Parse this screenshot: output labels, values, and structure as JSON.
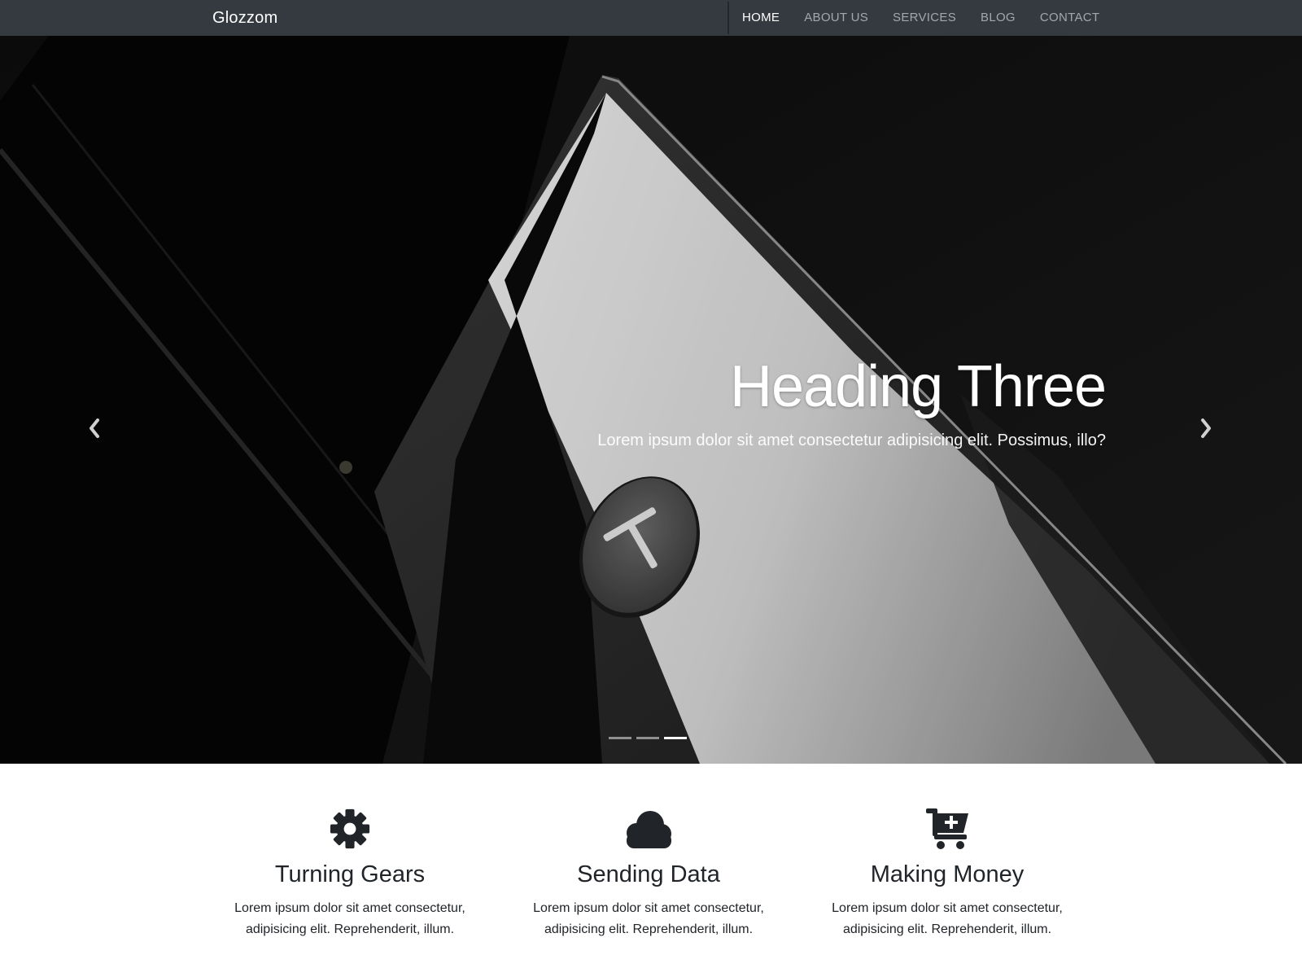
{
  "navbar": {
    "brand": "Glozzom",
    "links": [
      {
        "label": "HOME",
        "active": true
      },
      {
        "label": "ABOUT US",
        "active": false
      },
      {
        "label": "SERVICES",
        "active": false
      },
      {
        "label": "BLOG",
        "active": false
      },
      {
        "label": "CONTACT",
        "active": false
      }
    ]
  },
  "hero": {
    "title": "Heading Three",
    "text": "Lorem ipsum dolor sit amet consectetur adipisicing elit. Possimus, illo?",
    "prev_icon": "chevron-left-icon",
    "next_icon": "chevron-right-icon",
    "slide_count": 3,
    "active_slide": 3
  },
  "features": [
    {
      "icon": "gear-icon",
      "title": "Turning Gears",
      "line1": "Lorem ipsum dolor sit amet consectetur,",
      "line2": "adipisicing elit. Reprehenderit, illum."
    },
    {
      "icon": "cloud-icon",
      "title": "Sending Data",
      "line1": "Lorem ipsum dolor sit amet consectetur,",
      "line2": "adipisicing elit. Reprehenderit, illum."
    },
    {
      "icon": "cart-plus-icon",
      "title": "Making Money",
      "line1": "Lorem ipsum dolor sit amet consectetur,",
      "line2": "adipisicing elit. Reprehenderit, illum."
    }
  ],
  "colors": {
    "navbar_bg": "#343a40",
    "nav_link": "#a3a8ad",
    "nav_active": "#ffffff",
    "text_dark": "#212529"
  }
}
